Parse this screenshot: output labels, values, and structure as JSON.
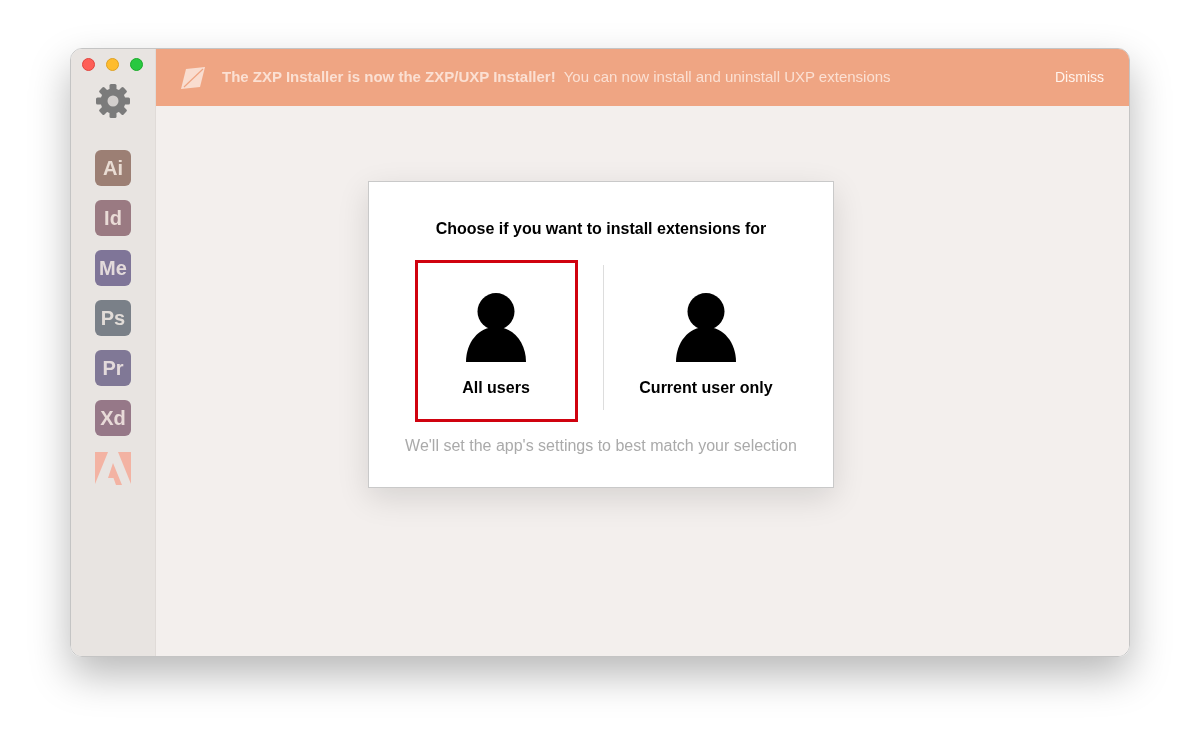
{
  "sidebar": {
    "items": [
      {
        "label": "Ai",
        "color": "#9c7f74"
      },
      {
        "label": "Id",
        "color": "#9a7a82"
      },
      {
        "label": "Me",
        "color": "#7f7598"
      },
      {
        "label": "Ps",
        "color": "#7a8088"
      },
      {
        "label": "Pr",
        "color": "#807896"
      },
      {
        "label": "Xd",
        "color": "#967888"
      }
    ]
  },
  "banner": {
    "title": "The ZXP Installer is now the ZXP/UXP Installer!",
    "message": "You can now install and uninstall UXP extensions",
    "dismiss": "Dismiss"
  },
  "dialog": {
    "title": "Choose if you want to install extensions for",
    "options": [
      {
        "label": "All users",
        "selected": true
      },
      {
        "label": "Current user only",
        "selected": false
      }
    ],
    "note": "We'll set the app's settings to best match your selection"
  }
}
